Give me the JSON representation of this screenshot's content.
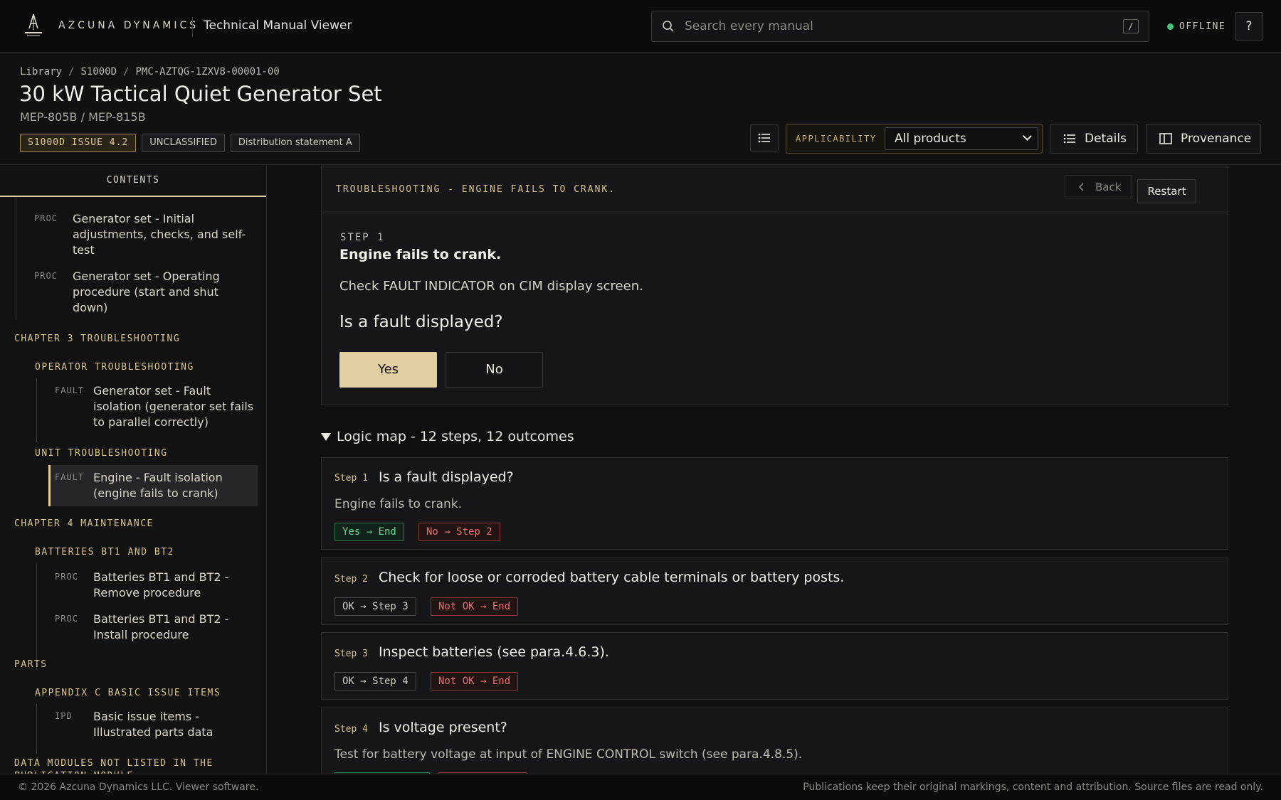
{
  "topbar": {
    "logo_text": "AZCUNA DYNAMICS",
    "brand": "AZCUNA DYNAMICS",
    "app_title": "Technical Manual Viewer",
    "search_placeholder": "Search every manual",
    "search_shortcut": "/",
    "status": "OFFLINE",
    "help_label": "?"
  },
  "header": {
    "breadcrumb": [
      "Library",
      "S1000D",
      "PMC-AZTQG-1ZXV8-00001-00"
    ],
    "title": "30 kW Tactical Quiet Generator Set",
    "subtitle": "MEP-805B / MEP-815B",
    "badges": [
      "S1000D ISSUE 4.2",
      "UNCLASSIFIED",
      "Distribution statement A"
    ],
    "applicability_label": "APPLICABILITY",
    "applicability_value": "All products",
    "details_label": "Details",
    "provenance_label": "Provenance"
  },
  "sidebar": {
    "heading": "CONTENTS",
    "items": [
      {
        "tag": "PROC",
        "text": "Generator set - Initial adjustments, checks, and self-test"
      },
      {
        "tag": "PROC",
        "text": "Generator set - Operating procedure (start and shut down)"
      },
      {
        "chapter": "CHAPTER 3 TROUBLESHOOTING"
      },
      {
        "section": "OPERATOR TROUBLESHOOTING"
      },
      {
        "tag": "FAULT",
        "text": "Generator set - Fault isolation (generator set fails to parallel correctly)"
      },
      {
        "section": "UNIT TROUBLESHOOTING"
      },
      {
        "tag": "FAULT",
        "text": "Engine - Fault isolation (engine fails to crank)"
      },
      {
        "chapter": "CHAPTER 4 MAINTENANCE"
      },
      {
        "section": "BATTERIES BT1 AND BT2"
      },
      {
        "tag": "PROC",
        "text": "Batteries BT1 and BT2 - Remove procedure"
      },
      {
        "tag": "PROC",
        "text": "Batteries BT1 and BT2 - Install procedure"
      },
      {
        "chapter": "PARTS"
      },
      {
        "section": "APPENDIX C BASIC ISSUE ITEMS"
      },
      {
        "tag": "IPD",
        "text": "Basic issue items - Illustrated parts data"
      },
      {
        "chapter": "DATA MODULES NOT LISTED IN THE PUBLICATION MODULE"
      }
    ]
  },
  "panel": {
    "title": "TROUBLESHOOTING - ENGINE FAILS TO CRANK.",
    "back_label": "Back",
    "restart_label": "Restart",
    "step_label": "STEP 1",
    "step_title": "Engine fails to crank.",
    "step_desc": "Check FAULT INDICATOR on CIM display screen.",
    "question": "Is a fault displayed?",
    "yes_label": "Yes",
    "no_label": "No"
  },
  "logic_map": {
    "summary": "Logic map - 12 steps, 12 outcomes",
    "steps": [
      {
        "label": "Step 1",
        "question": "Is a fault displayed?",
        "note": "Engine fails to crank.",
        "outcomes": [
          {
            "text": "Yes → End",
            "kind": "ok"
          },
          {
            "text": "No → Step 2",
            "kind": "bad"
          }
        ]
      },
      {
        "label": "Step 2",
        "question": "Check for loose or corroded battery cable terminals or battery posts.",
        "note": "",
        "outcomes": [
          {
            "text": "OK → Step 3",
            "kind": "neutral"
          },
          {
            "text": "Not OK → End",
            "kind": "bad"
          }
        ]
      },
      {
        "label": "Step 3",
        "question": "Inspect batteries (see para.4.6.3).",
        "note": "",
        "outcomes": [
          {
            "text": "OK → Step 4",
            "kind": "neutral"
          },
          {
            "text": "Not OK → End",
            "kind": "bad"
          }
        ]
      },
      {
        "label": "Step 4",
        "question": "Is voltage present?",
        "note": "Test for battery voltage at input of ENGINE CONTROL switch (see para.4.8.5).",
        "outcomes": []
      }
    ]
  },
  "footer": {
    "left": "© 2026 Azcuna Dynamics LLC. Viewer software.",
    "right": "Publications keep their original markings, content and attribution. Source files are read only."
  },
  "colors": {
    "accent": "#e0cfa0",
    "ok": "#4cc37a",
    "bad": "#e57272"
  }
}
